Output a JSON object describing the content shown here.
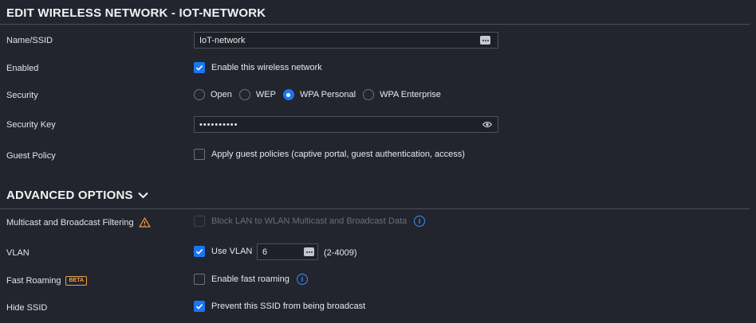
{
  "page": {
    "title": "EDIT WIRELESS NETWORK - IOT-NETWORK"
  },
  "fields": {
    "name_label": "Name/SSID",
    "name_value": "IoT-network",
    "enabled_label": "Enabled",
    "enabled_checkbox_label": "Enable this wireless network",
    "enabled_checked": true,
    "security_label": "Security",
    "security_options": [
      "Open",
      "WEP",
      "WPA Personal",
      "WPA Enterprise"
    ],
    "security_selected": "WPA Personal",
    "security_key_label": "Security Key",
    "security_key_value": "••••••••••",
    "guest_policy_label": "Guest Policy",
    "guest_policy_checkbox_label": "Apply guest policies (captive portal, guest authentication, access)",
    "guest_policy_checked": false
  },
  "advanced": {
    "title": "ADVANCED OPTIONS",
    "multicast_label": "Multicast and Broadcast Filtering",
    "multicast_checkbox_label": "Block LAN to WLAN Multicast and Broadcast Data",
    "multicast_disabled": true,
    "vlan_label": "VLAN",
    "vlan_checkbox_label": "Use VLAN",
    "vlan_checked": true,
    "vlan_value": "6",
    "vlan_range": "(2-4009)",
    "fast_roaming_label": "Fast Roaming",
    "fast_roaming_badge": "BETA",
    "fast_roaming_checkbox_label": "Enable fast roaming",
    "fast_roaming_checked": false,
    "hide_ssid_label": "Hide SSID",
    "hide_ssid_checkbox_label": "Prevent this SSID from being broadcast",
    "hide_ssid_checked": true
  },
  "colors": {
    "background": "#22252d",
    "accent": "#1877f2",
    "warning": "#f0a04b",
    "info": "#3d8bff"
  }
}
